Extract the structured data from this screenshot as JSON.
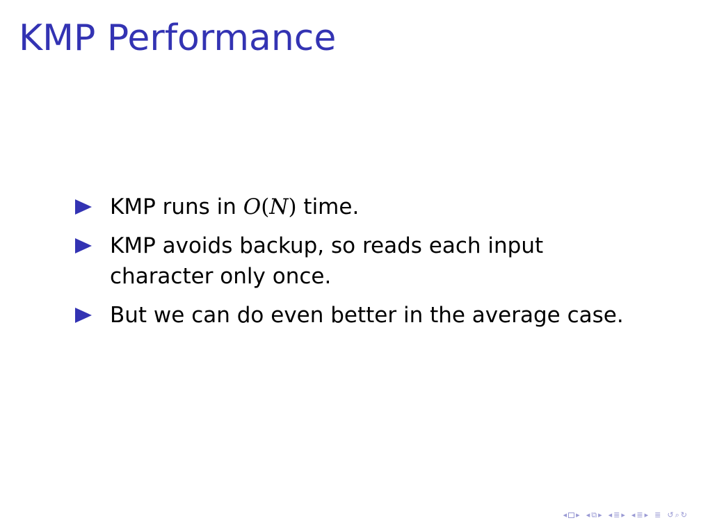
{
  "slide": {
    "title": "KMP Performance",
    "bullets": [
      {
        "text_before": "KMP runs in ",
        "math": {
          "func": "O",
          "open": "(",
          "var": "N",
          "close": ")"
        },
        "text_after": " time."
      },
      {
        "text": "KMP avoids backup, so reads each input character only once."
      },
      {
        "text": "But we can do even better in the average case."
      }
    ]
  },
  "colors": {
    "title": "#3333b3",
    "bullet_marker": "#3333b3",
    "nav": "#9a9ad4"
  },
  "navigation": {
    "icons": [
      "nav-frame-prev",
      "nav-frame-next",
      "nav-subsection-prev",
      "nav-subsection-next",
      "nav-section-prev",
      "nav-section-next",
      "nav-appendix",
      "nav-search"
    ]
  }
}
